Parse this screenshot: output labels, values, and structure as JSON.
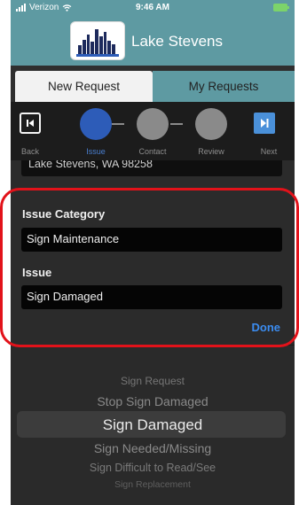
{
  "status_bar": {
    "carrier": "Verizon",
    "time": "9:46 AM"
  },
  "header": {
    "title": "Lake Stevens",
    "logo_icon": "city-skyline-icon"
  },
  "tabs": [
    {
      "label": "New Request",
      "active": true
    },
    {
      "label": "My Requests",
      "active": false
    }
  ],
  "stepper": {
    "back_label": "Back",
    "next_label": "Next",
    "steps": [
      {
        "label": "Issue",
        "active": true
      },
      {
        "label": "Contact",
        "active": false
      },
      {
        "label": "Review",
        "active": false
      }
    ]
  },
  "address": {
    "value": "Lake Stevens, WA 98258"
  },
  "form": {
    "category_label": "Issue Category",
    "category_value": "Sign Maintenance",
    "issue_label": "Issue",
    "issue_value": "Sign Damaged",
    "done_label": "Done"
  },
  "picker": {
    "options": [
      "Sign Request",
      "Stop Sign Damaged",
      "Sign Damaged",
      "Sign Needed/Missing",
      "Sign Difficult to Read/See",
      "Sign Replacement"
    ],
    "selected": "Sign Damaged"
  },
  "colors": {
    "header_teal": "#5e9aa2",
    "active_step": "#2d5cb8",
    "done_blue": "#3b8cf0",
    "annotation_red": "#e2121a"
  }
}
